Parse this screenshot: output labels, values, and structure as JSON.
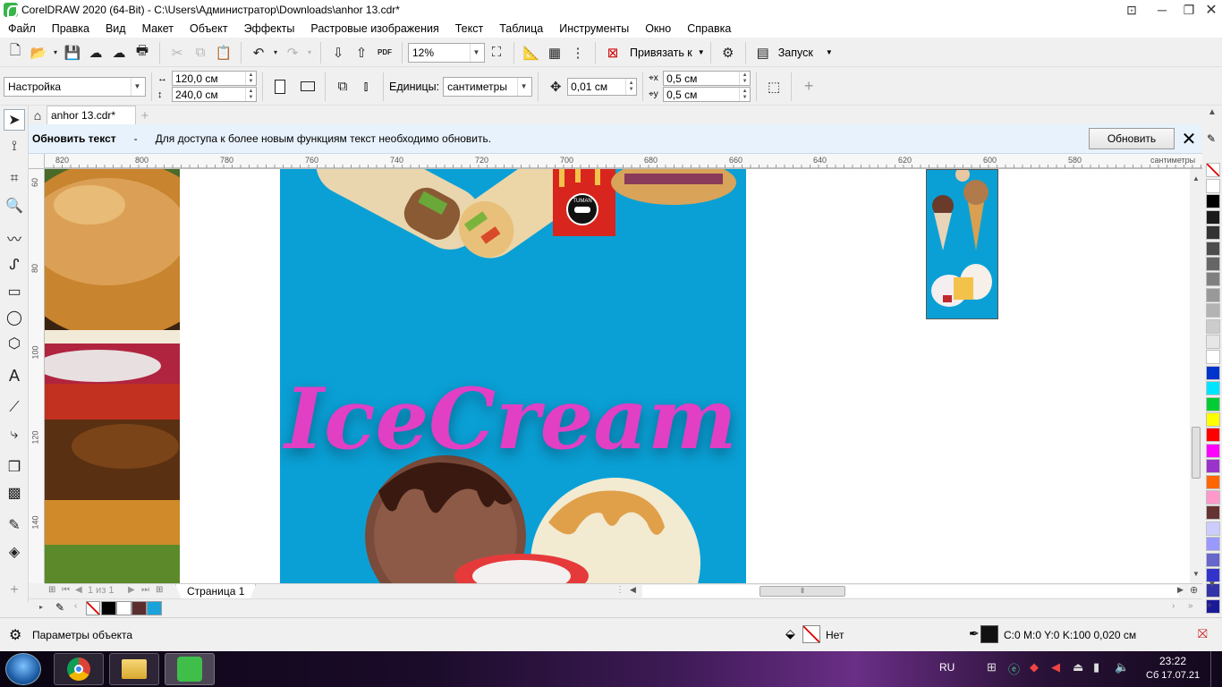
{
  "window": {
    "title": "CorelDRAW 2020 (64-Bit) - C:\\Users\\Администратор\\Downloads\\anhor 13.cdr*"
  },
  "menu": [
    "Файл",
    "Правка",
    "Вид",
    "Макет",
    "Объект",
    "Эффекты",
    "Растровые изображения",
    "Текст",
    "Таблица",
    "Инструменты",
    "Окно",
    "Справка"
  ],
  "standard_toolbar": {
    "zoom_value": "12%",
    "snap_label": "Привязать к",
    "launch_label": "Запуск",
    "pdf_label": "PDF"
  },
  "property_bar": {
    "preset_value": "Настройка",
    "width_value": "120,0 см",
    "height_value": "240,0 см",
    "units_label": "Единицы:",
    "units_value": "сантиметры",
    "nudge_value": "0,01 см",
    "dup_x_value": "0,5 см",
    "dup_y_value": "0,5 см"
  },
  "document_tab": {
    "label": "anhor 13.cdr*"
  },
  "hint_bar": {
    "title": "Обновить текст",
    "dash": "-",
    "message": "Для доступа к более новым функциям текст необходимо обновить.",
    "button_label": "Обновить"
  },
  "ruler": {
    "h_ticks": [
      "820",
      "800",
      "780",
      "760",
      "740",
      "720",
      "700",
      "680",
      "660",
      "640",
      "620",
      "600",
      "580"
    ],
    "unit": "сантиметры",
    "v_ticks": [
      "60",
      "80",
      "100",
      "120",
      "140"
    ]
  },
  "artwork": {
    "icecream_text": "IceCream",
    "badge_text": "TUMAN"
  },
  "page_nav": {
    "counter": "1 из 1",
    "page_tab": "Страница 1"
  },
  "status": {
    "object_params": "Параметры объекта",
    "fill_label": "Нет",
    "outline_label": "C:0 M:0 Y:0 K:100  0,020 см"
  },
  "taskbar": {
    "lang": "RU",
    "time": "23:22",
    "date": "Сб 17.07.21"
  },
  "colors": {
    "poster_blue": "#0aa0d6",
    "icecream_pink": "#e13fc4",
    "hint_bg": "#e8f2fc"
  },
  "palette_colors": [
    "#ffffff",
    "#000000",
    "#1a1a1a",
    "#333333",
    "#4d4d4d",
    "#666666",
    "#808080",
    "#999999",
    "#b3b3b3",
    "#cccccc",
    "#e6e6e6",
    "#ffffff",
    "#0033cc",
    "#00e5ff",
    "#00cc33",
    "#ffff00",
    "#ff0000",
    "#ff00ff",
    "#9933cc",
    "#ff6600",
    "#ff99cc",
    "#663333",
    "#ccccff",
    "#9999ff",
    "#6666cc",
    "#3333cc",
    "#3333aa",
    "#1a1a99"
  ],
  "doc_palette_colors": [
    "#000000",
    "#ffffff",
    "#5a2e2e",
    "#1aa3db"
  ]
}
